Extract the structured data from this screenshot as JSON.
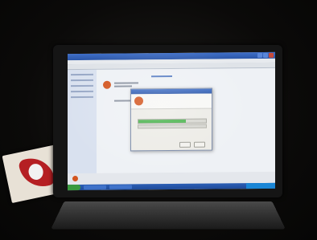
{
  "scene": {
    "description_colors": {
      "screen_bg": "#cfd8e6",
      "titlebar": "#2b56a8",
      "progress": "#47b24a",
      "ubuntu_orange": "#d3551f",
      "book_red": "#b51f23"
    }
  },
  "window": {
    "title": "",
    "menu": [
      "",
      "",
      "",
      ""
    ]
  },
  "dialog": {
    "title": "",
    "progress": 0.7
  },
  "icons": [
    "ubuntu-logo-icon",
    "start-button-icon"
  ]
}
